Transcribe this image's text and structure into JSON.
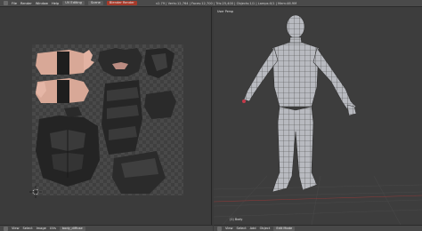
{
  "header": {
    "menus": [
      "File",
      "Render",
      "Window",
      "Help"
    ],
    "layout": "UV Editing",
    "scene": "Scene",
    "engine": "Blender Render",
    "title": "v2.79 | Verts:12,764 | Faces:12,700 | Tris:25,400 | Objects:1/1 | Lamps:0/1 | Mem:46.9M"
  },
  "uv_editor": {
    "bottom_menus": [
      "View",
      "Select",
      "Image",
      "UVs"
    ],
    "image_name": "body_diffuse"
  },
  "viewport": {
    "label": "User Persp",
    "object_label": "(1) Body",
    "bottom_menus": [
      "View",
      "Select",
      "Add",
      "Object"
    ],
    "mode": "Edit Mode"
  },
  "colors": {
    "background": "#3a3a3a",
    "header": "#4a4a4a",
    "mesh": "#b8bac0",
    "wire": "#3a3a3a",
    "accent": "#a63a2a"
  }
}
